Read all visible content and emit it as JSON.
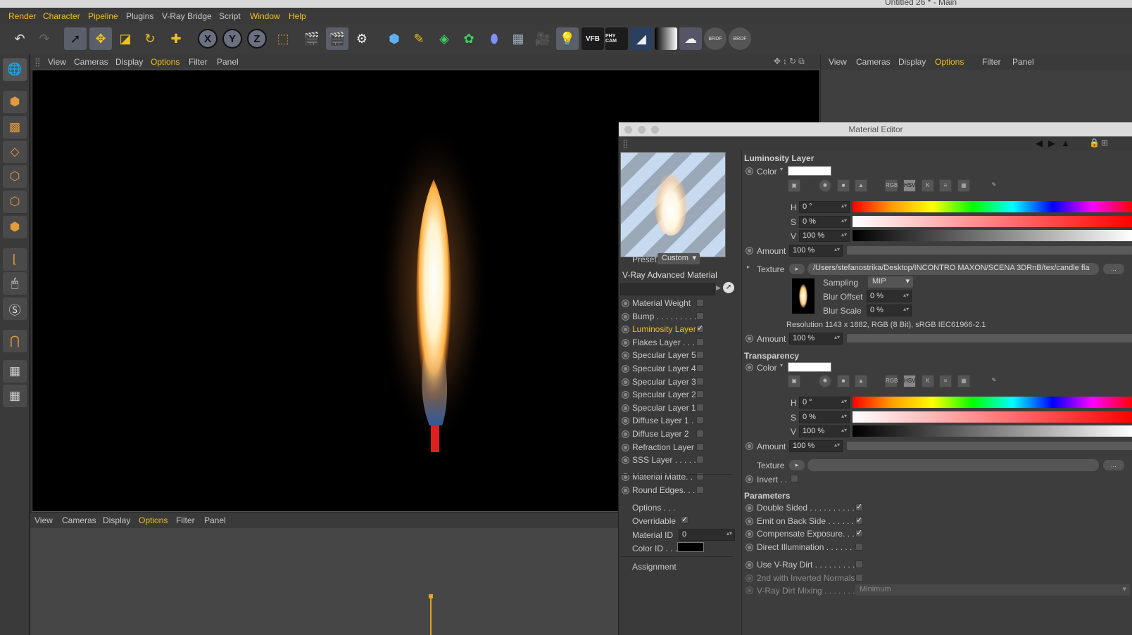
{
  "window": {
    "title": "Untitled 26 * - Main"
  },
  "menu": [
    "Render",
    "Character",
    "Pipeline",
    "Plugins",
    "V-Ray Bridge",
    "Script",
    "Window",
    "Help"
  ],
  "toolbar_labels": {
    "vfb": "VFB",
    "phycam": "PHY CAM",
    "brdf1": "BRDF",
    "brdf2": "BRDF"
  },
  "viewport_tabs": [
    "View",
    "Cameras",
    "Display",
    "Options",
    "Filter",
    "Panel"
  ],
  "material_editor": {
    "title": "Material Editor",
    "preset_label": "Preset",
    "preset_value": "Custom",
    "material_name": "V-Ray Advanced Material",
    "channels": [
      {
        "label": "Material Weight",
        "checked": false
      },
      {
        "label": "Bump . . . . . . . . .",
        "checked": false
      },
      {
        "label": "Luminosity Layer",
        "checked": true,
        "active": true
      },
      {
        "label": "Flakes Layer . . .",
        "checked": false
      },
      {
        "label": "Specular Layer 5",
        "checked": false
      },
      {
        "label": "Specular Layer 4",
        "checked": false
      },
      {
        "label": "Specular Layer 3",
        "checked": false
      },
      {
        "label": "Specular Layer 2",
        "checked": false
      },
      {
        "label": "Specular Layer 1",
        "checked": false
      },
      {
        "label": "Diffuse Layer 1 .",
        "checked": false
      },
      {
        "label": "Diffuse Layer 2",
        "checked": false
      },
      {
        "label": "Refraction Layer",
        "checked": false
      },
      {
        "label": "SSS Layer . . . . .",
        "checked": false
      }
    ],
    "extras": [
      {
        "label": "Material Matte. .",
        "checked": false
      },
      {
        "label": "Round Edges. . .",
        "checked": false
      }
    ],
    "options_label": "Options . . .",
    "overridable_label": "Overridable",
    "material_id_label": "Material ID",
    "material_id_value": "0",
    "color_id_label": "Color ID . . .",
    "assignment_label": "Assignment",
    "luminosity": {
      "header": "Luminosity Layer",
      "color_label": "Color",
      "h_label": "H",
      "h_value": "0 °",
      "s_label": "S",
      "s_value": "0 %",
      "v_label": "V",
      "v_value": "100 %",
      "amount_label": "Amount",
      "amount_value": "100 %",
      "texture_label": "Texture",
      "texture_path": "/Users/stefanostrika/Desktop/INCONTRO MAXON/SCENA 3DRnB/tex/candle fla",
      "more": "...",
      "sampling_label": "Sampling",
      "sampling_value": "MIP",
      "blur_offset_label": "Blur Offset",
      "blur_offset_value": "0 %",
      "blur_scale_label": "Blur Scale",
      "blur_scale_value": "0 %",
      "resolution": "Resolution 1143 x 1882, RGB (8 Bit), sRGB IEC61966-2.1",
      "amount2_label": "Amount",
      "amount2_value": "100 %"
    },
    "transparency": {
      "header": "Transparency",
      "color_label": "Color",
      "h_label": "H",
      "h_value": "0 °",
      "s_label": "S",
      "s_value": "0 %",
      "v_label": "V",
      "v_value": "100 %",
      "amount_label": "Amount",
      "amount_value": "100 %",
      "texture_label": "Texture",
      "more": "...",
      "invert_label": "Invert . ."
    },
    "color_icons": [
      "RGB",
      "HSV",
      "K"
    ],
    "parameters": {
      "header": "Parameters",
      "items": [
        {
          "label": "Double Sided . . . . . . . . . . .",
          "checked": true
        },
        {
          "label": "Emit on Back Side . . . . . . .",
          "checked": true
        },
        {
          "label": "Compensate Exposure. . . .",
          "checked": true
        },
        {
          "label": "Direct Illumination . . . . . . .",
          "checked": false
        }
      ],
      "dirt_items": [
        {
          "label": "Use V-Ray Dirt . . . . . . . . . .",
          "checked": false
        },
        {
          "label": "2nd with Inverted Normals",
          "checked": false
        }
      ],
      "dirt_mixing_label": "V-Ray Dirt Mixing . . . . . . . .",
      "dirt_mixing_value": "Minimum"
    }
  },
  "colors": {
    "accent": "#f0c020",
    "panel": "#3a3a3a",
    "viewport": "#000000"
  }
}
